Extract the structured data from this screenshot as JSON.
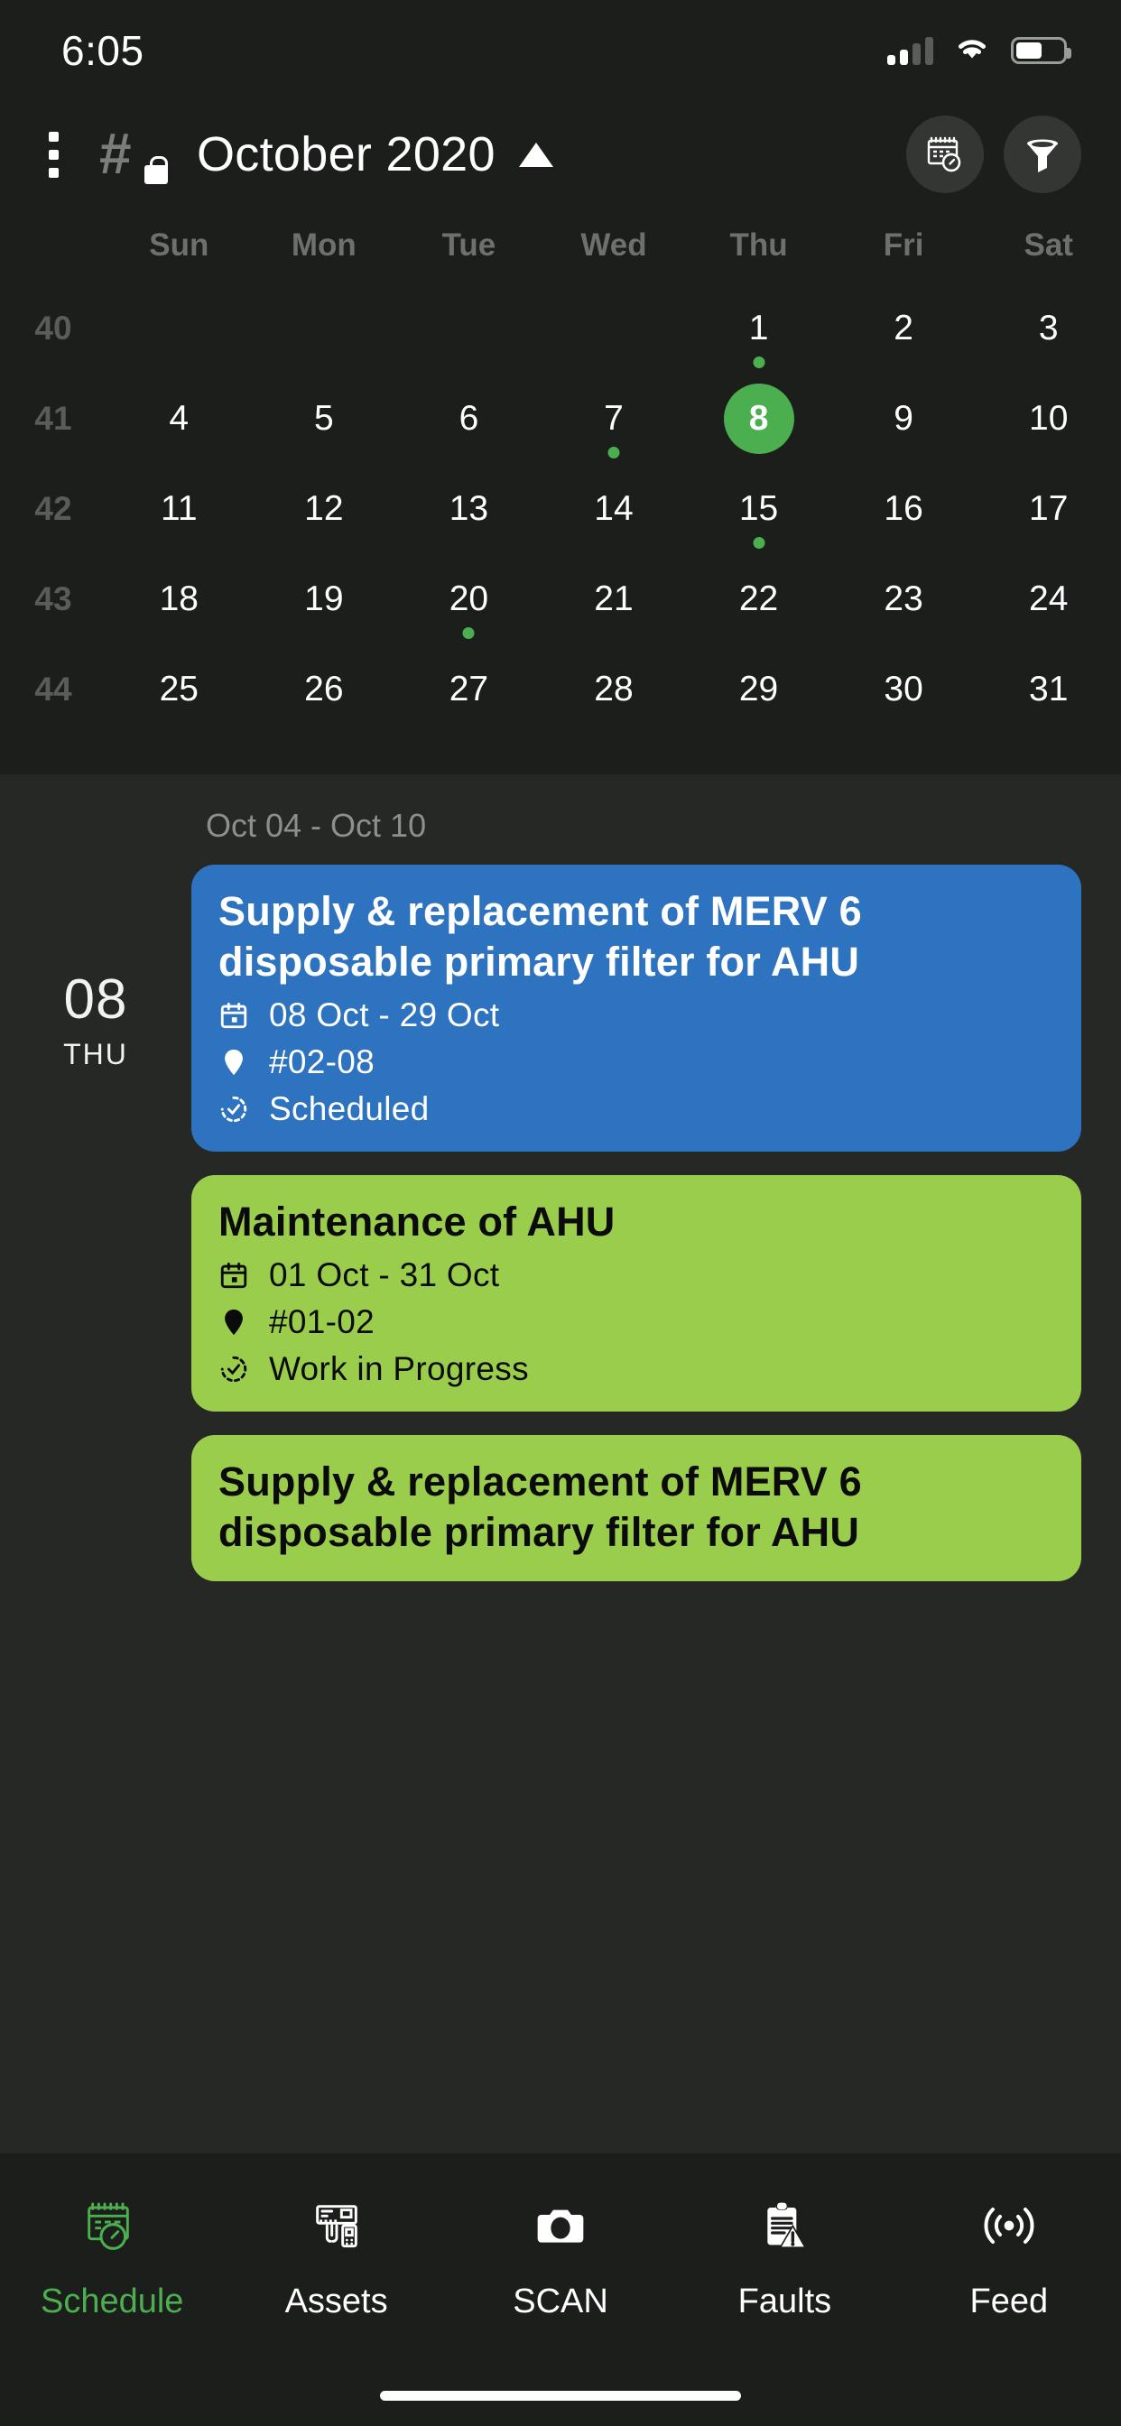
{
  "status_bar": {
    "time": "6:05",
    "signal_icon": "signal-bars-icon",
    "wifi_icon": "wifi-icon",
    "battery_icon": "battery-icon"
  },
  "header": {
    "menu_icon": "kebab-menu-icon",
    "hash_lock_icon": "hash-lock-icon",
    "title": "October 2020",
    "collapse_icon": "triangle-up-icon",
    "calendar_clock_icon": "calendar-clock-icon",
    "filter_icon": "filter-funnel-icon"
  },
  "calendar": {
    "weekdays": [
      "Sun",
      "Mon",
      "Tue",
      "Wed",
      "Thu",
      "Fri",
      "Sat"
    ],
    "selected_day": 8,
    "accent_color": "#4BAE4F",
    "weeks": [
      {
        "week_number": "40",
        "days": [
          "",
          "",
          "",
          "",
          "1",
          "2",
          "3"
        ],
        "dots": [
          4
        ]
      },
      {
        "week_number": "41",
        "days": [
          "4",
          "5",
          "6",
          "7",
          "8",
          "9",
          "10"
        ],
        "dots": [
          3
        ]
      },
      {
        "week_number": "42",
        "days": [
          "11",
          "12",
          "13",
          "14",
          "15",
          "16",
          "17"
        ],
        "dots": [
          4
        ]
      },
      {
        "week_number": "43",
        "days": [
          "18",
          "19",
          "20",
          "21",
          "22",
          "23",
          "24"
        ],
        "dots": [
          2
        ]
      },
      {
        "week_number": "44",
        "days": [
          "25",
          "26",
          "27",
          "28",
          "29",
          "30",
          "31"
        ],
        "dots": []
      }
    ]
  },
  "agenda": {
    "range_label": "Oct 04 - Oct 10",
    "day_number": "08",
    "day_weekday": "THU",
    "events": [
      {
        "title": "Supply & replacement of MERV 6 disposable primary filter for AHU",
        "date_range": "08 Oct - 29 Oct",
        "location": "#02-08",
        "status": "Scheduled",
        "color": "#2E73C0",
        "theme": "blue"
      },
      {
        "title": "Maintenance of AHU",
        "date_range": "01 Oct - 31 Oct",
        "location": "#01-02",
        "status": "Work in Progress",
        "color": "#9BCD4C",
        "theme": "green"
      },
      {
        "title": "Supply & replacement of MERV 6 disposable primary filter for AHU",
        "date_range": "",
        "location": "",
        "status": "",
        "color": "#9BCD4C",
        "theme": "green"
      }
    ]
  },
  "tabbar": {
    "active": "Schedule",
    "items": [
      {
        "label": "Schedule",
        "icon": "calendar-clock-icon",
        "active": true
      },
      {
        "label": "Assets",
        "icon": "assets-equipment-icon",
        "active": false
      },
      {
        "label": "SCAN",
        "icon": "camera-icon",
        "active": false
      },
      {
        "label": "Faults",
        "icon": "clipboard-warning-icon",
        "active": false
      },
      {
        "label": "Feed",
        "icon": "broadcast-signal-icon",
        "active": false
      }
    ]
  }
}
